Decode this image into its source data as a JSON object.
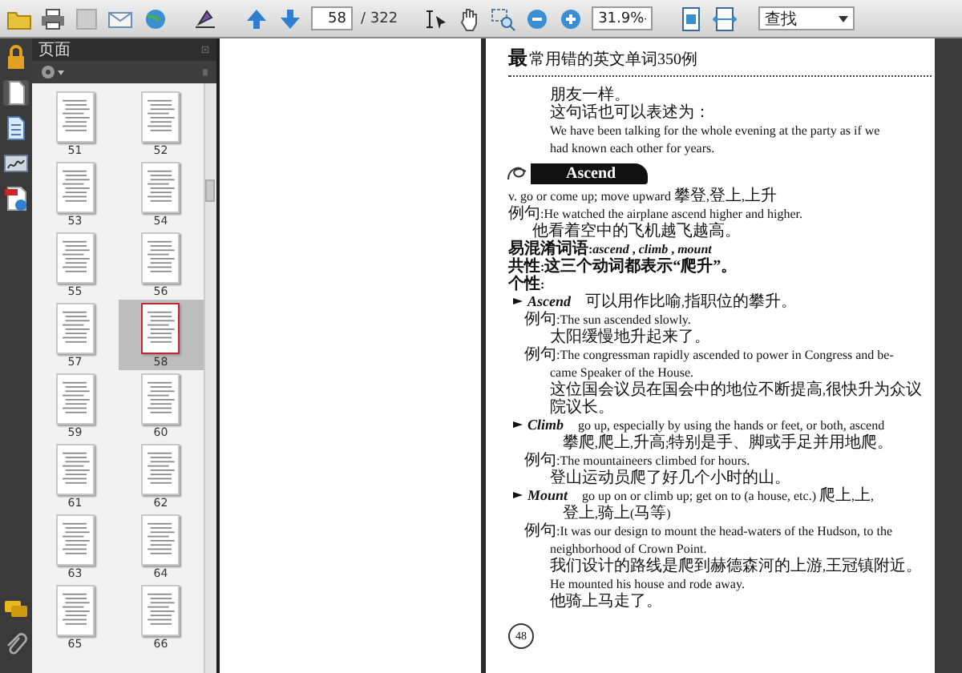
{
  "toolbar": {
    "page_number": "58",
    "page_total": "/ 322",
    "zoom": "31.9%",
    "find": "查找"
  },
  "pages_panel": {
    "title": "页面",
    "thumbnails": [
      {
        "label": "51",
        "selected": false
      },
      {
        "label": "52",
        "selected": false
      },
      {
        "label": "53",
        "selected": false
      },
      {
        "label": "54",
        "selected": false
      },
      {
        "label": "55",
        "selected": false
      },
      {
        "label": "56",
        "selected": false
      },
      {
        "label": "57",
        "selected": false
      },
      {
        "label": "58",
        "selected": true
      },
      {
        "label": "59",
        "selected": false
      },
      {
        "label": "60",
        "selected": false
      },
      {
        "label": "61",
        "selected": false
      },
      {
        "label": "62",
        "selected": false
      },
      {
        "label": "63",
        "selected": false
      },
      {
        "label": "64",
        "selected": false
      },
      {
        "label": "65",
        "selected": false
      },
      {
        "label": "66",
        "selected": false
      }
    ]
  },
  "document": {
    "header_mark": "最",
    "header_title": "常用错的英文单词350例",
    "page_number": "48",
    "blocks": [
      {
        "kind": "continuation",
        "text": "朋友一样。"
      },
      {
        "kind": "continuation",
        "text": "这句话也可以表述为："
      },
      {
        "kind": "continuation",
        "text": "We have been talking for the whole evening at the party as if we"
      },
      {
        "kind": "continuation",
        "text": "had known each other for years."
      },
      {
        "kind": "banner",
        "text": "Ascend"
      },
      {
        "kind": "body",
        "text": "v.    go or come up; move upward    攀登,登上,上升"
      },
      {
        "kind": "body",
        "text": "例句:He watched the airplane ascend higher and higher."
      },
      {
        "kind": "gloss",
        "text": "他看着空中的飞机越飞越高。"
      },
      {
        "kind": "heading",
        "text": "易混淆词语:*ascend* , *climb* , *mount*"
      },
      {
        "kind": "heading",
        "text": "共性:这三个动词都表示“爬升”。"
      },
      {
        "kind": "heading",
        "text": "个性:"
      },
      {
        "kind": "term",
        "term": "Ascend",
        "text": "可以用作比喻,指职位的攀升。"
      },
      {
        "kind": "example",
        "text": "例句:The sun ascended slowly."
      },
      {
        "kind": "continuation",
        "text": "太阳缓慢地升起来了。"
      },
      {
        "kind": "example",
        "text": "例句:The congressman rapidly ascended to power in Congress and be-"
      },
      {
        "kind": "continuation",
        "text": "came Speaker of the House."
      },
      {
        "kind": "continuation",
        "text": "这位国会议员在国会中的地位不断提高,很快升为众议院议长。"
      },
      {
        "kind": "term",
        "term": "Climb",
        "text": "go up, especially by using the hands or feet, or both, ascend"
      },
      {
        "kind": "definition",
        "text": "攀爬,爬上,升高;特别是手、脚或手足并用地爬。"
      },
      {
        "kind": "example",
        "text": "例句:The mountaineers climbed for hours."
      },
      {
        "kind": "continuation",
        "text": "登山运动员爬了好几个小时的山。"
      },
      {
        "kind": "term",
        "term": "Mount",
        "text": "go up on or climb up; get on to (a house, etc.)   爬上,上,"
      },
      {
        "kind": "definition",
        "text": "登上,骑上(马等)"
      },
      {
        "kind": "example",
        "text": "例句:It was our design to mount the head-waters of the Hudson, to the"
      },
      {
        "kind": "continuation",
        "text": "neighborhood of Crown Point."
      },
      {
        "kind": "continuation",
        "text": "我们设计的路线是爬到赫德森河的上游,王冠镇附近。"
      },
      {
        "kind": "continuation",
        "text": "He mounted his house and rode away."
      },
      {
        "kind": "continuation",
        "text": "他骑上马走了。"
      }
    ]
  }
}
